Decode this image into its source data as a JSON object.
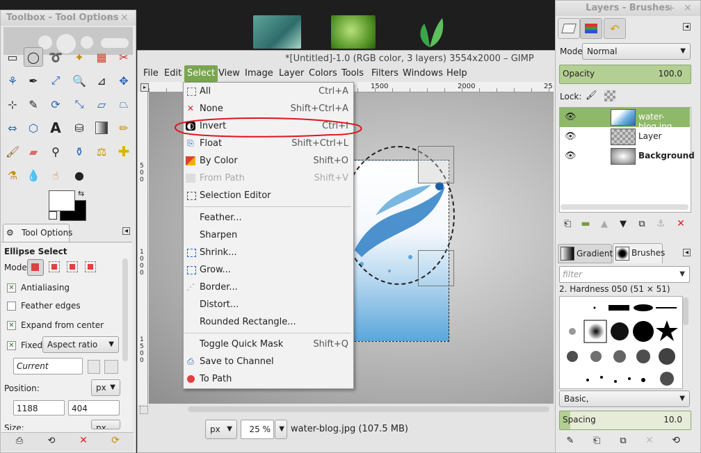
{
  "toolbox": {
    "title": "Toolbox - Tool Options",
    "tab_label": "Tool Options",
    "tool_name": "Ellipse Select",
    "mode_label": "Mode:",
    "antialiasing": "Antialiasing",
    "feather_edges": "Feather edges",
    "expand_from_center": "Expand from center",
    "fixed_label": "Fixed:",
    "fixed_value": "Aspect ratio",
    "fixed_field": "Current",
    "position_label": "Position:",
    "position_unit": "px",
    "pos_x": "1188",
    "pos_y": "404",
    "size_label": "Size:",
    "size_unit": "px"
  },
  "main": {
    "title": "*[Untitled]-1.0 (RGB color, 3 layers) 3554x2000 – GIMP",
    "menus": [
      "File",
      "Edit",
      "Select",
      "View",
      "Image",
      "Layer",
      "Colors",
      "Tools",
      "Filters",
      "Windows",
      "Help"
    ],
    "ruler_h": [
      "1500",
      "2000",
      "25"
    ],
    "ruler_v": [
      "5",
      "0",
      "0",
      "1",
      "0",
      "0",
      "0",
      "1",
      "5",
      "0",
      "0"
    ],
    "status_unit": "px",
    "zoom": "25 %",
    "status_text": "water-blog.jpg (107.5 MB)"
  },
  "select_menu": {
    "items": [
      {
        "label": "All",
        "shortcut": "Ctrl+A",
        "icon": "select-all-icon"
      },
      {
        "label": "None",
        "shortcut": "Shift+Ctrl+A",
        "icon": "select-none-icon"
      },
      {
        "label": "Invert",
        "shortcut": "Ctrl+I",
        "icon": "invert-icon"
      },
      {
        "label": "Float",
        "shortcut": "Shift+Ctrl+L",
        "icon": "float-icon"
      },
      {
        "label": "By Color",
        "shortcut": "Shift+O",
        "icon": "by-color-icon"
      },
      {
        "label": "From Path",
        "shortcut": "Shift+V",
        "icon": "from-path-icon"
      },
      {
        "label": "Selection Editor",
        "shortcut": "",
        "icon": "selection-editor-icon"
      },
      {
        "label": "Feather...",
        "shortcut": "",
        "icon": ""
      },
      {
        "label": "Sharpen",
        "shortcut": "",
        "icon": ""
      },
      {
        "label": "Shrink...",
        "shortcut": "",
        "icon": "shrink-icon"
      },
      {
        "label": "Grow...",
        "shortcut": "",
        "icon": "grow-icon"
      },
      {
        "label": "Border...",
        "shortcut": "",
        "icon": "border-icon"
      },
      {
        "label": "Distort...",
        "shortcut": "",
        "icon": ""
      },
      {
        "label": "Rounded Rectangle...",
        "shortcut": "",
        "icon": ""
      },
      {
        "label": "Toggle Quick Mask",
        "shortcut": "Shift+Q",
        "icon": ""
      },
      {
        "label": "Save to Channel",
        "shortcut": "",
        "icon": "save-channel-icon"
      },
      {
        "label": "To Path",
        "shortcut": "",
        "icon": "to-path-icon"
      }
    ]
  },
  "layers": {
    "title": "Layers - Brushes",
    "mode_label": "Mode:",
    "mode_value": "Normal",
    "opacity_label": "Opacity",
    "opacity_value": "100.0",
    "lock_label": "Lock:",
    "rows": [
      "water-blog.jpg",
      "Layer",
      "Background"
    ]
  },
  "brushes": {
    "tab_gradients": "Gradients",
    "tab_brushes": "Brushes",
    "filter_placeholder": "filter",
    "brush_name": "2. Hardness 050 (51 × 51)",
    "preset": "Basic,",
    "spacing_label": "Spacing",
    "spacing_value": "10.0"
  },
  "colors": {
    "accent": "#7aa550",
    "annotation": "#e0141e"
  }
}
